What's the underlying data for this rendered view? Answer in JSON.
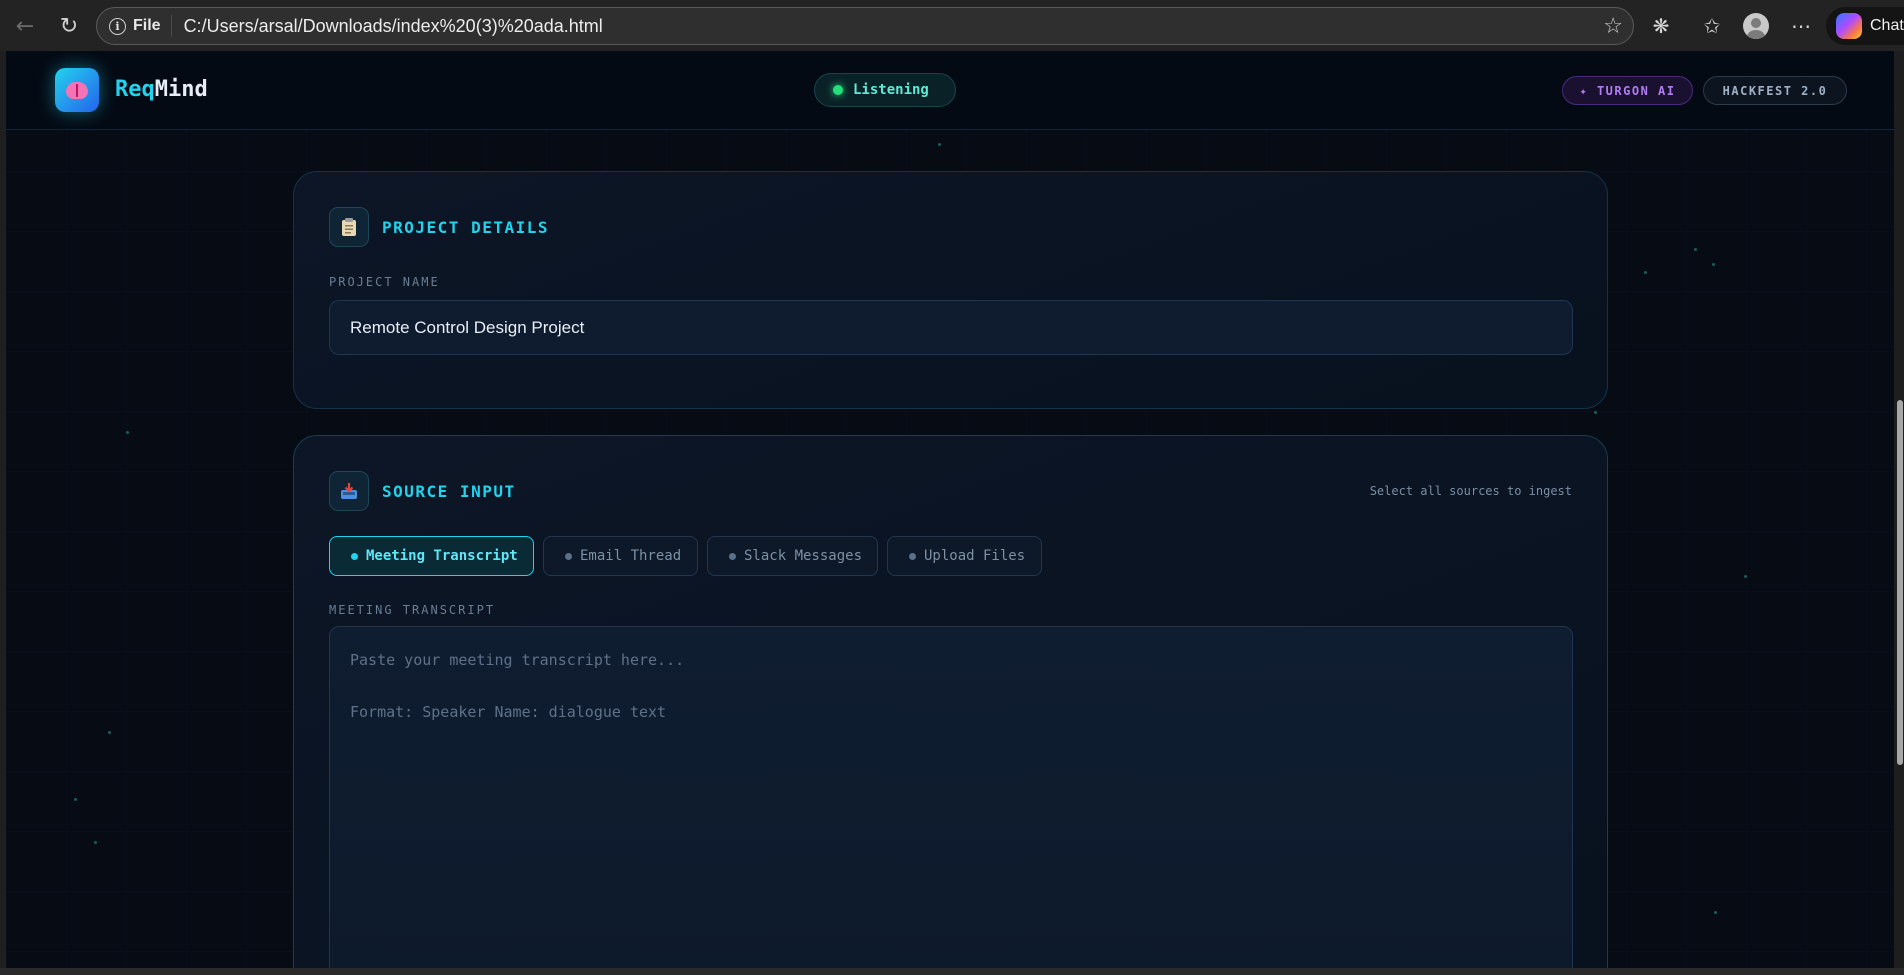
{
  "browser": {
    "scheme_label": "File",
    "url": "C:/Users/arsal/Downloads/index%20(3)%20ada.html",
    "copilot_label": "Chat"
  },
  "header": {
    "brand_first": "Req",
    "brand_second": "Mind",
    "status": "Listening",
    "badges": [
      "✦ TURGON AI",
      "HACKFEST 2.0"
    ]
  },
  "project": {
    "title": "PROJECT DETAILS",
    "field_label": "PROJECT NAME",
    "project_name": "Remote Control Design Project"
  },
  "source": {
    "title": "SOURCE INPUT",
    "hint": "Select all sources to ingest",
    "tabs": [
      {
        "label": "Meeting Transcript",
        "active": true
      },
      {
        "label": "Email Thread",
        "active": false
      },
      {
        "label": "Slack Messages",
        "active": false
      },
      {
        "label": "Upload Files",
        "active": false
      }
    ],
    "field_label": "MEETING TRANSCRIPT",
    "placeholder": "Paste your meeting transcript here...\n\nFormat: Speaker Name: dialogue text"
  },
  "colors": {
    "accent": "#22d3ee",
    "status_green": "#22e07a",
    "purple": "#b07cf5",
    "background": "#060b14"
  }
}
